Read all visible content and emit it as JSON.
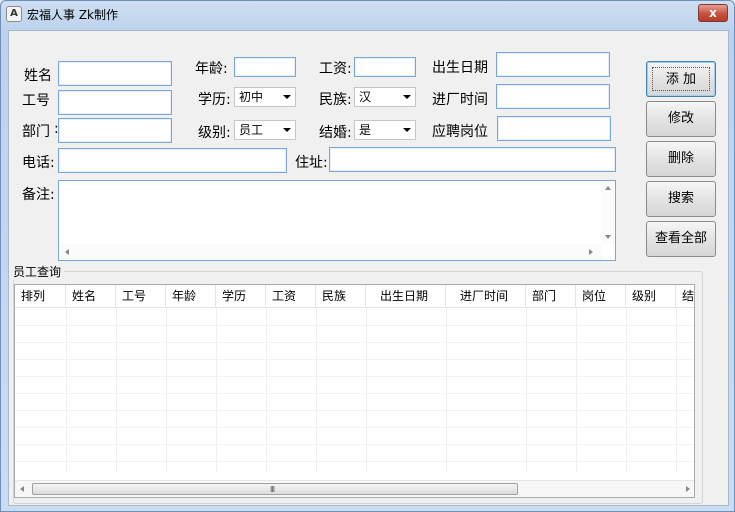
{
  "window": {
    "title": "宏福人事 Zk制作",
    "icon_letter": "A",
    "close_glyph": "x"
  },
  "form": {
    "name_label": "姓名",
    "id_label": "工号",
    "dept_label": "部门",
    "age_label": "年龄:",
    "edu_label": "学历:",
    "level_label": "级别:",
    "salary_label": "工资:",
    "ethnic_label": "民族:",
    "married_label": "结婚:",
    "birth_label": "出生日期",
    "join_label": "进厂时间",
    "position_label": "应聘岗位",
    "phone_label": "电话:",
    "address_label": "住址:",
    "note_label": "备注:",
    "colon": ":",
    "edu_value": "初中",
    "level_value": "员工",
    "ethnic_value": "汉",
    "married_value": "是",
    "grip": "III"
  },
  "buttons": {
    "add": "添 加",
    "edit": "修改",
    "delete": "删除",
    "search": "搜索",
    "view_all": "查看全部"
  },
  "table": {
    "group_title": "员工查询",
    "columns": [
      "排列",
      "姓名",
      "工号",
      "年龄",
      "学历",
      "工资",
      "民族",
      "出生日期",
      "进厂时间",
      "部门",
      "岗位",
      "级别",
      "结婚"
    ]
  }
}
